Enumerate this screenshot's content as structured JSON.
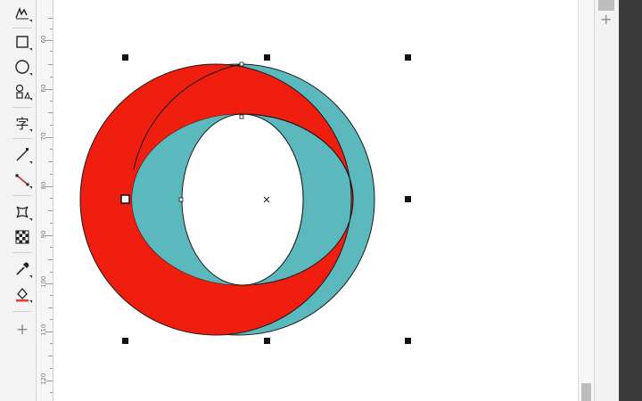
{
  "toolbox": {
    "tools": [
      {
        "name": "freehand-tool-icon"
      },
      {
        "name": "rectangle-tool-icon"
      },
      {
        "name": "ellipse-tool-icon"
      },
      {
        "name": "shape-tool-icon"
      },
      {
        "name": "text-tool-icon",
        "glyph": "字"
      },
      {
        "name": "line-tool-icon"
      },
      {
        "name": "connector-tool-icon"
      },
      {
        "name": "envelope-tool-icon"
      },
      {
        "name": "transparency-tool-icon"
      },
      {
        "name": "eyedropper-tool-icon"
      },
      {
        "name": "fill-tool-icon"
      }
    ],
    "add_label": "+"
  },
  "ruler": {
    "labels": [
      "60",
      "60",
      "70",
      "80",
      "90",
      "100",
      "110",
      "120"
    ]
  },
  "docker": {
    "add_label": "+"
  },
  "shapes": {
    "red_ring_color": "#f01e0e",
    "teal_ring_color": "#5bb8bd",
    "outline_color": "#1a1a1a"
  }
}
